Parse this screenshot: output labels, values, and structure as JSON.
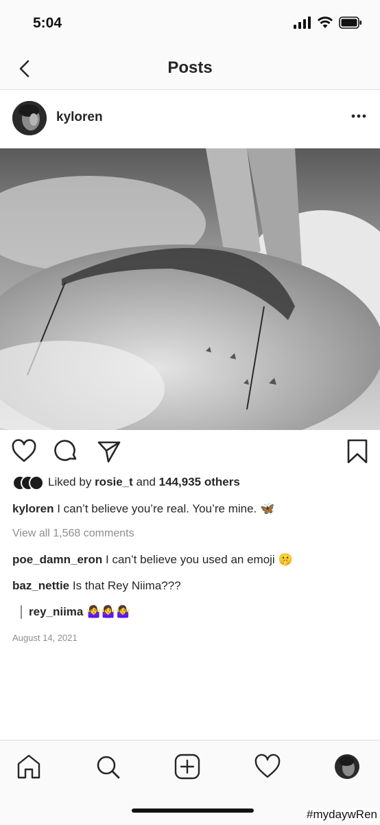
{
  "status": {
    "time": "5:04"
  },
  "nav": {
    "title": "Posts",
    "back_icon": "chevron-left-icon"
  },
  "post": {
    "username": "kyloren",
    "more_icon": "ellipsis-icon",
    "photo_description": "black-and-white photo",
    "likes": {
      "prefix": "Liked by",
      "user": "rosie_t",
      "middle": "and",
      "count": "144,935 others"
    },
    "caption": {
      "user": "kyloren",
      "text": "I can’t believe you’re real. You’re mine.",
      "emoji": "🦋"
    },
    "view_all": "View all 1,568 comments",
    "comments": [
      {
        "user": "poe_damn_eron",
        "text": "I can’t believe you used an emoji",
        "emoji": "🤫"
      },
      {
        "user": "baz_nettie",
        "text": "Is that Rey Niima???",
        "emoji": ""
      }
    ],
    "reply": {
      "user": "rey_niima",
      "emoji": "🤷‍♀️🤷‍♀️🤷‍♀️"
    },
    "date": "August 14, 2021"
  },
  "tabs": [
    "home-icon",
    "search-icon",
    "new-post-icon",
    "activity-heart-icon",
    "profile-avatar"
  ],
  "watermark": "#mydaywRen",
  "colors": {
    "text": "#262626",
    "muted": "#8e8e8e",
    "divider": "#dbdbdb",
    "bar_bg": "#fafafa"
  }
}
